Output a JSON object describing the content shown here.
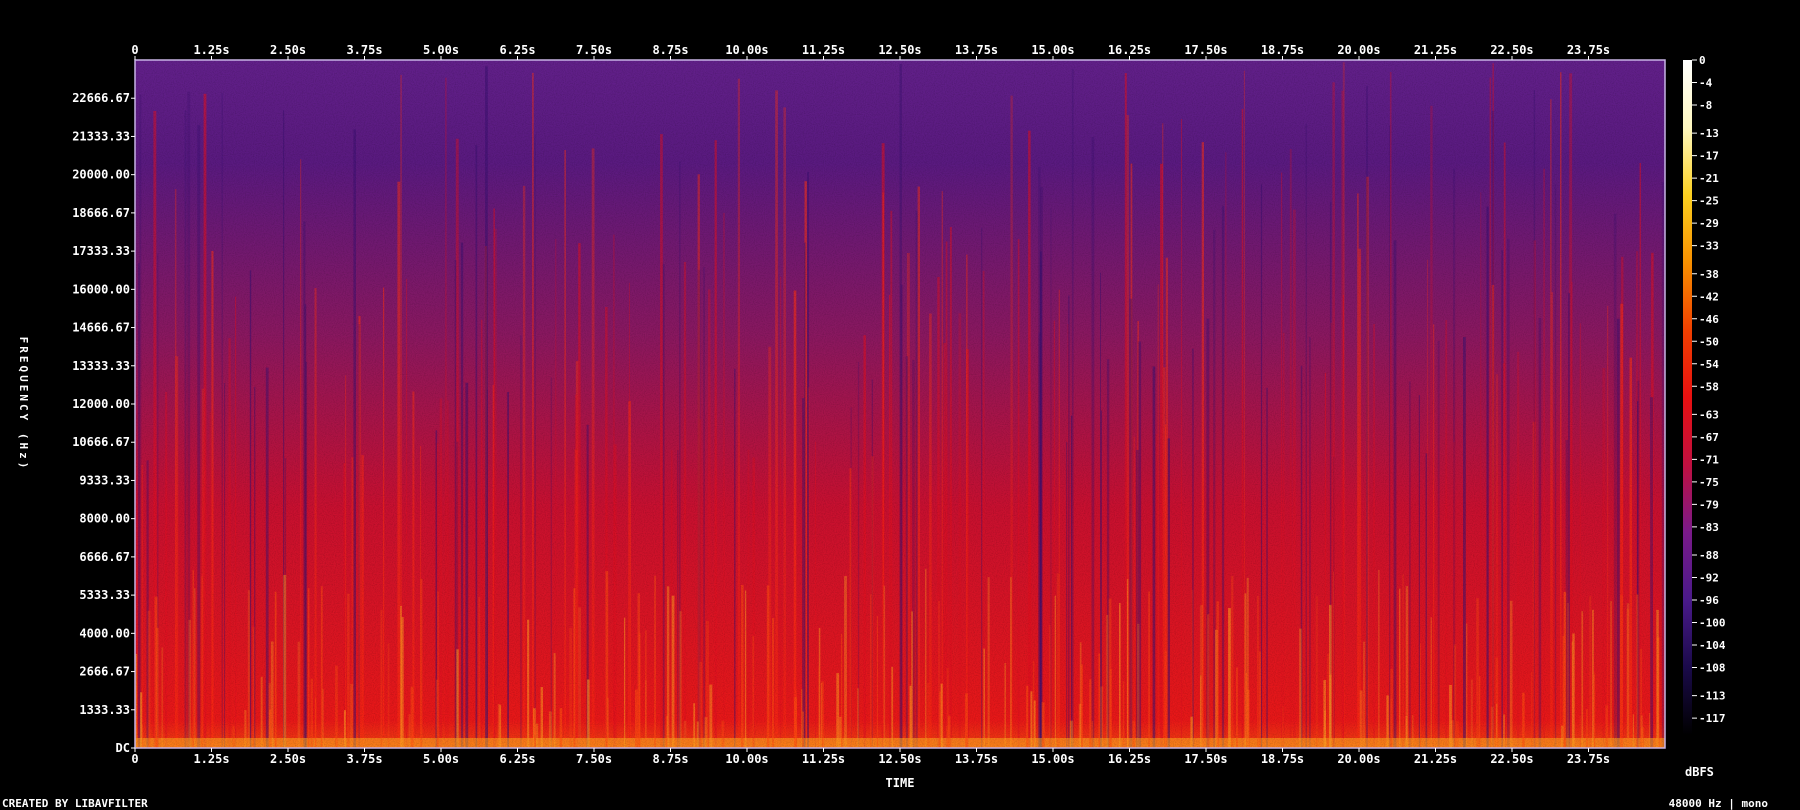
{
  "chart_data": {
    "type": "heatmap",
    "title": "",
    "xlabel": "TIME",
    "ylabel": "FREQUENCY (Hz)",
    "x_ticks": [
      "0",
      "1.25s",
      "2.50s",
      "3.75s",
      "5.00s",
      "6.25s",
      "7.50s",
      "8.75s",
      "10.00s",
      "11.25s",
      "12.50s",
      "13.75s",
      "15.00s",
      "16.25s",
      "17.50s",
      "18.75s",
      "20.00s",
      "21.25s",
      "22.50s",
      "23.75s"
    ],
    "x_tick_values": [
      0,
      1.25,
      2.5,
      3.75,
      5,
      6.25,
      7.5,
      8.75,
      10,
      11.25,
      12.5,
      13.75,
      15,
      16.25,
      17.5,
      18.75,
      20,
      21.25,
      22.5,
      23.75
    ],
    "xlim": [
      0,
      25
    ],
    "y_ticks": [
      "DC",
      "1333.33",
      "2666.67",
      "4000.00",
      "5333.33",
      "6666.67",
      "8000.00",
      "9333.33",
      "10666.67",
      "12000.00",
      "13333.33",
      "14666.67",
      "16000.00",
      "17333.33",
      "18666.67",
      "20000.00",
      "21333.33",
      "22666.67"
    ],
    "y_tick_values": [
      0,
      1333.33,
      2666.67,
      4000,
      5333.33,
      6666.67,
      8000,
      9333.33,
      10666.67,
      12000,
      13333.33,
      14666.67,
      16000,
      17333.33,
      18666.67,
      20000,
      21333.33,
      22666.67
    ],
    "ylim": [
      0,
      24000
    ],
    "colorbar": {
      "label": "dBFS",
      "ticks": [
        "0",
        "-4",
        "-8",
        "-13",
        "-17",
        "-21",
        "-25",
        "-29",
        "-33",
        "-38",
        "-42",
        "-46",
        "-50",
        "-54",
        "-58",
        "-63",
        "-67",
        "-71",
        "-75",
        "-79",
        "-83",
        "-88",
        "-92",
        "-96",
        "-100",
        "-104",
        "-108",
        "-113",
        "-117"
      ],
      "range": [
        -120,
        0
      ],
      "colors": [
        "#000000",
        "#1a0a4a",
        "#4a1a8a",
        "#7a1a8a",
        "#c01040",
        "#e81010",
        "#f04000",
        "#f89000",
        "#fcd020",
        "#fff8c0",
        "#ffffff"
      ]
    },
    "grid": false,
    "legend": "colorbar right"
  },
  "footer": {
    "created_by": "CREATED BY LIBAVFILTER",
    "stream_info": "48000 Hz | mono"
  },
  "colors": {
    "background": "#000000",
    "frame": "#c8b4e6",
    "text": "#ffffff"
  }
}
